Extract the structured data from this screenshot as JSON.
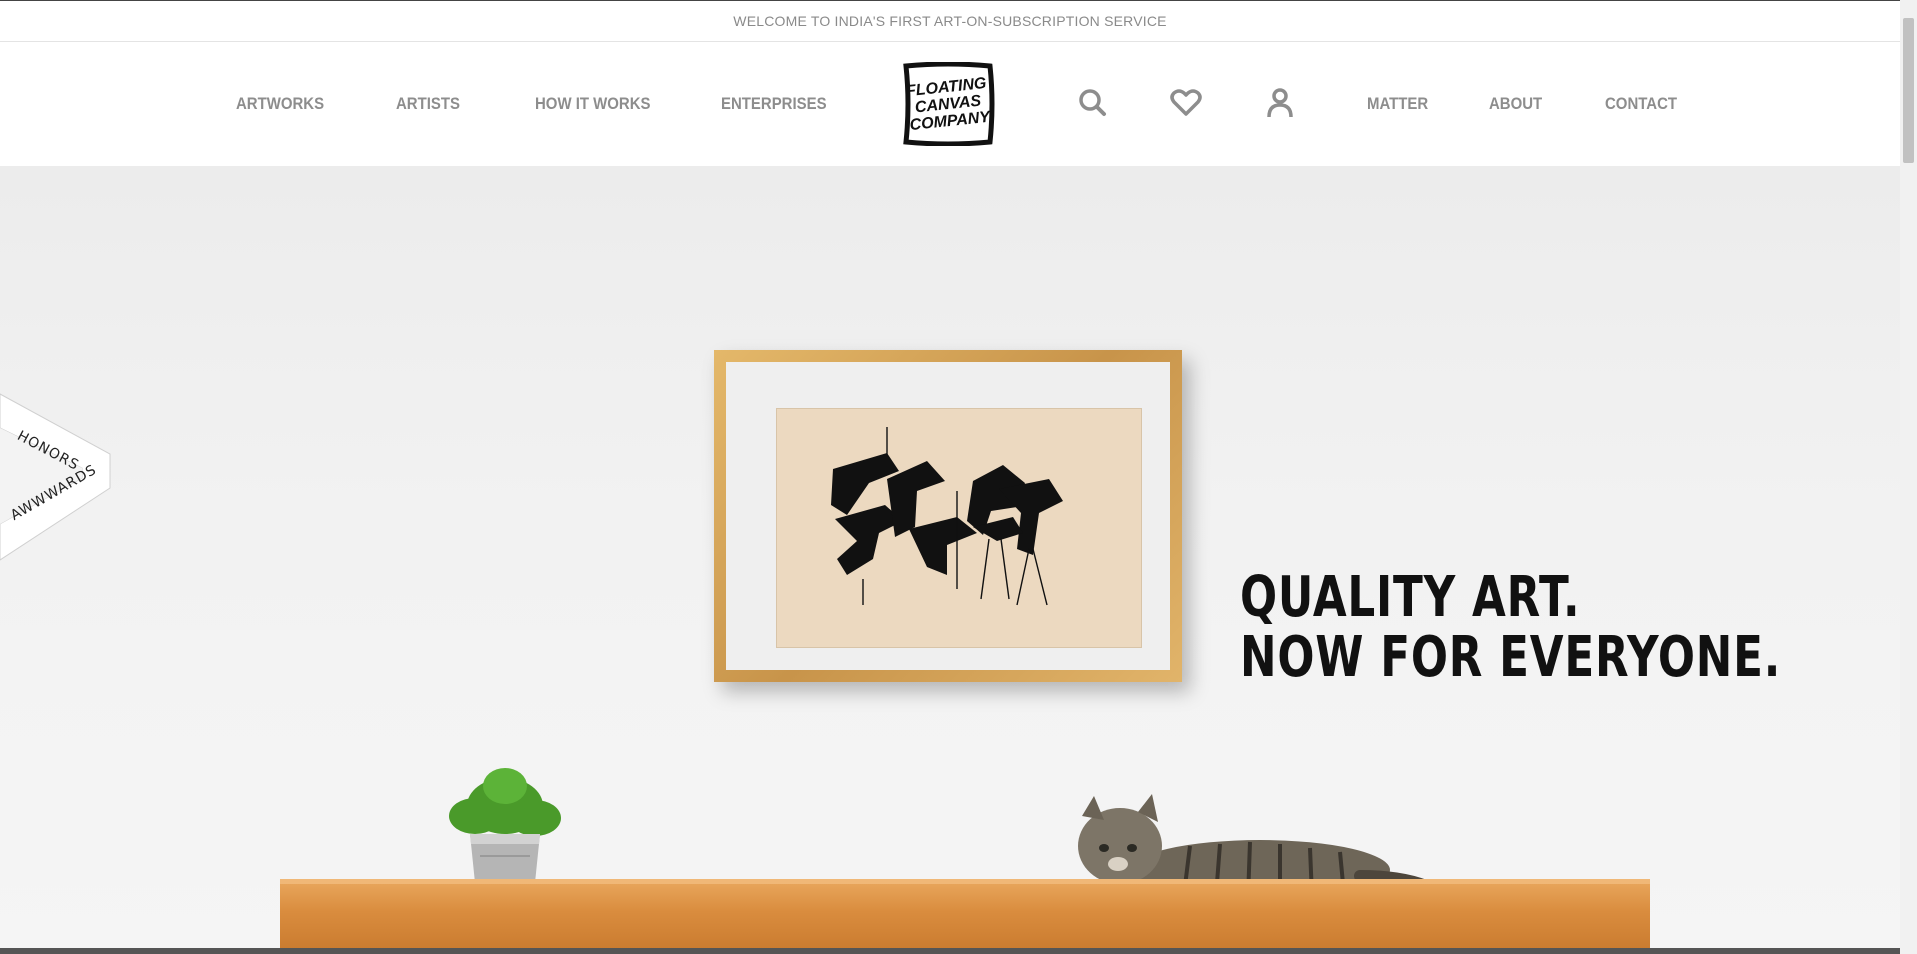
{
  "announcement": "WELCOME TO INDIA'S FIRST ART-ON-SUBSCRIPTION SERVICE",
  "nav": {
    "artworks": "ARTWORKS",
    "artists": "ARTISTS",
    "how_it_works": "HOW IT WORKS",
    "enterprises": "ENTERPRISES",
    "matter": "MATTER",
    "about": "ABOUT",
    "contact": "CONTACT"
  },
  "logo": {
    "line1": "FLOATING",
    "line2": "CANVAS",
    "line3": "COMPANY"
  },
  "icons": [
    "search-icon",
    "heart-icon",
    "user-icon"
  ],
  "hero": {
    "headline_line1": "QUALITY ART.",
    "headline_line2": "NOW FOR EVERYONE."
  },
  "award": {
    "line1": "HONORS",
    "line2": "AWWWARDS"
  },
  "colors": {
    "nav_text": "#8d8d8d",
    "headline": "#111111",
    "award_accent": "#3aa6a0"
  }
}
